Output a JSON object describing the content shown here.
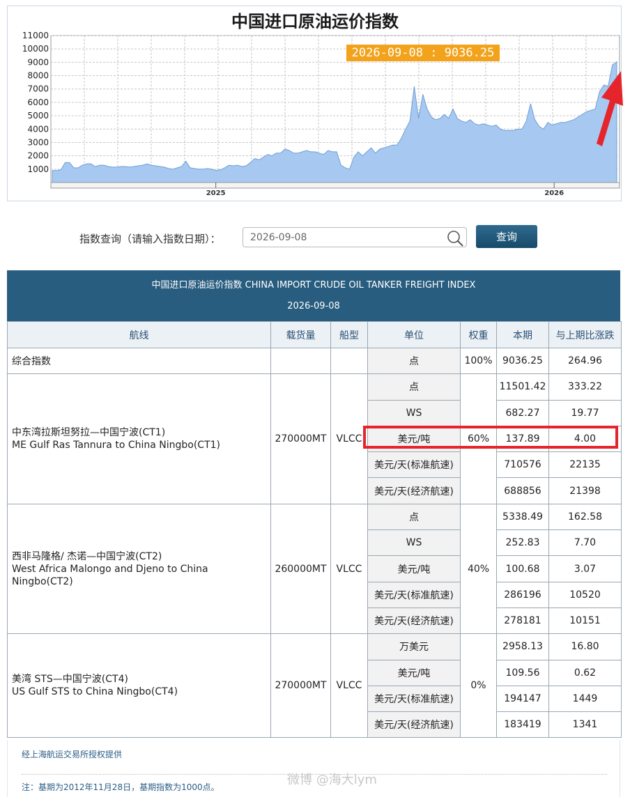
{
  "chart_data": {
    "type": "area",
    "title": "中国进口原油运价指数",
    "x_tick_labels": [
      "2025",
      "2026"
    ],
    "yticks": [
      1000,
      2000,
      3000,
      4000,
      5000,
      6000,
      7000,
      8000,
      9000,
      10000,
      11000
    ],
    "ylim": [
      0,
      11000
    ],
    "tooltip": "2026-09-08 : 9036.25",
    "grid": true,
    "area_color": "#a7c8f0",
    "line_color": "#6f9fd6",
    "series": [
      {
        "values": [
          900,
          900,
          950,
          1500,
          1500,
          1100,
          1100,
          1300,
          1400,
          1400,
          1200,
          1300,
          1300,
          1200,
          1150,
          1150,
          1200,
          1200,
          1150,
          1200,
          1250,
          1300,
          1400,
          1300,
          1250,
          1200,
          1150,
          1050,
          1000,
          1100,
          1200,
          1600,
          1100,
          1050,
          1000,
          1000,
          1050,
          1000,
          900,
          950,
          1100,
          1300,
          1250,
          1300,
          1200,
          1250,
          1500,
          1800,
          1700,
          1900,
          2100,
          2000,
          2200,
          2200,
          2500,
          2400,
          2200,
          2200,
          2300,
          2400,
          2300,
          2300,
          2200,
          2100,
          2400,
          2300,
          2300,
          1300,
          1100,
          1000,
          1900,
          2300,
          2000,
          2300,
          2600,
          2200,
          2500,
          2600,
          2700,
          2800,
          2800,
          3300,
          4000,
          4600,
          7200,
          4800,
          6600,
          5500,
          4900,
          4700,
          4800,
          5100,
          4800,
          5500,
          4800,
          4600,
          4500,
          4700,
          4400,
          4300,
          4400,
          4300,
          4200,
          4300,
          4000,
          3900,
          3900,
          3900,
          4000,
          4000,
          4600,
          5900,
          4700,
          4200,
          4000,
          4500,
          4300,
          4400,
          4500,
          4500,
          4600,
          4700,
          4900,
          5100,
          5300,
          5400,
          5500,
          6800,
          7300,
          7200,
          8800,
          9036
        ]
      }
    ]
  },
  "query": {
    "label": "指数查询（请输入指数日期）：",
    "input_value": "2026-09-08",
    "button_label": "查询"
  },
  "table": {
    "title": "中国进口原油运价指数 CHINA IMPORT CRUDE OIL TANKER FREIGHT INDEX",
    "date": "2026-09-08",
    "headers": [
      "航线",
      "载货量",
      "船型",
      "单位",
      "权重",
      "本期",
      "与上期比涨跌"
    ],
    "composite": {
      "name": "综合指数",
      "unit": "点",
      "weight": "100%",
      "current": "9036.25",
      "change": "264.96"
    },
    "routes": [
      {
        "name_cn": "中东湾拉斯坦努拉—中国宁波(CT1)",
        "name_en": "ME Gulf Ras Tannura to China Ningbo(CT1)",
        "cargo": "270000MT",
        "ship": "VLCC",
        "weight": "60%",
        "rows": [
          {
            "unit": "点",
            "current": "11501.42",
            "change": "333.22"
          },
          {
            "unit": "WS",
            "current": "682.27",
            "change": "19.77"
          },
          {
            "unit": "美元/吨",
            "current": "137.89",
            "change": "4.00"
          },
          {
            "unit": "美元/天(标准航速)",
            "current": "710576",
            "change": "22135"
          },
          {
            "unit": "美元/天(经济航速)",
            "current": "688856",
            "change": "21398"
          }
        ]
      },
      {
        "name_cn": "西非马隆格/ 杰诺—中国宁波(CT2)",
        "name_en": "West Africa Malongo and Djeno to China Ningbo(CT2)",
        "cargo": "260000MT",
        "ship": "VLCC",
        "weight": "40%",
        "rows": [
          {
            "unit": "点",
            "current": "5338.49",
            "change": "162.58"
          },
          {
            "unit": "WS",
            "current": "252.83",
            "change": "7.70"
          },
          {
            "unit": "美元/吨",
            "current": "100.68",
            "change": "3.07"
          },
          {
            "unit": "美元/天(标准航速)",
            "current": "286196",
            "change": "10520"
          },
          {
            "unit": "美元/天(经济航速)",
            "current": "278181",
            "change": "10151"
          }
        ]
      },
      {
        "name_cn": "美湾 STS—中国宁波(CT4)",
        "name_en": "US Gulf STS to China Ningbo(CT4)",
        "cargo": "270000MT",
        "ship": "VLCC",
        "weight": "0%",
        "rows": [
          {
            "unit": "万美元",
            "current": "2958.13",
            "change": "16.80"
          },
          {
            "unit": "美元/吨",
            "current": "109.56",
            "change": "0.62"
          },
          {
            "unit": "美元/天(标准航速)",
            "current": "194147",
            "change": "1449"
          },
          {
            "unit": "美元/天(经济航速)",
            "current": "183419",
            "change": "1341"
          }
        ]
      }
    ]
  },
  "footer": {
    "source": "经上海航运交易所授权提供",
    "note": "注：基期为2012年11月28日，基期指数为1000点。"
  },
  "watermark": "微博 @海大lym",
  "colors": {
    "highlight": "#e5252b",
    "header_bg": "#285d7f",
    "tooltip_bg": "#f3a21b"
  }
}
